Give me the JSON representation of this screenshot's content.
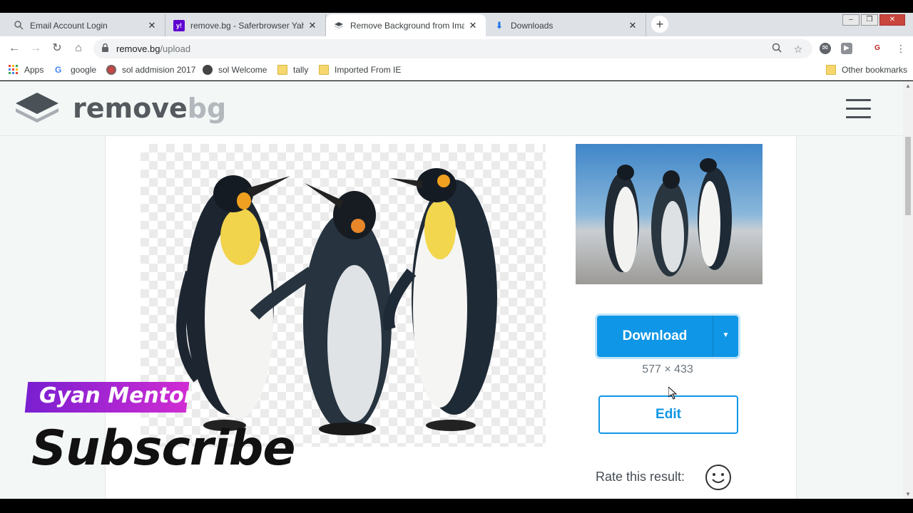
{
  "browser": {
    "tabs": [
      {
        "title": "Email Account Login",
        "icon": "search-icon",
        "active": false
      },
      {
        "title": "remove.bg - Saferbrowser Yahoo",
        "icon": "yahoo-icon",
        "active": false
      },
      {
        "title": "Remove Background from Image",
        "icon": "removebg-icon",
        "active": true
      },
      {
        "title": "Downloads",
        "icon": "download-icon",
        "active": false
      }
    ],
    "url_host": "remove.bg",
    "url_path": "/upload",
    "bookmarks": [
      {
        "label": "Apps",
        "icon": "apps-grid-icon"
      },
      {
        "label": "google",
        "icon": "google-icon"
      },
      {
        "label": "sol addmision 2017",
        "icon": "site-icon"
      },
      {
        "label": "sol Welcome",
        "icon": "globe-icon"
      },
      {
        "label": "tally",
        "icon": "folder-icon"
      },
      {
        "label": "Imported From IE",
        "icon": "folder-icon"
      },
      {
        "label": "Other bookmarks",
        "icon": "folder-icon"
      }
    ]
  },
  "site": {
    "logo_part1": "remove",
    "logo_part2": "bg"
  },
  "result": {
    "download_label": "Download",
    "dimensions": "577 × 433",
    "edit_label": "Edit",
    "rate_label": "Rate this result:"
  },
  "overlay": {
    "channel": "Gyan Mentor",
    "cta": "Subscribe"
  },
  "colors": {
    "accent": "#0f96e6",
    "page_bg": "#f3f7f6",
    "badge": "#a626d2"
  }
}
